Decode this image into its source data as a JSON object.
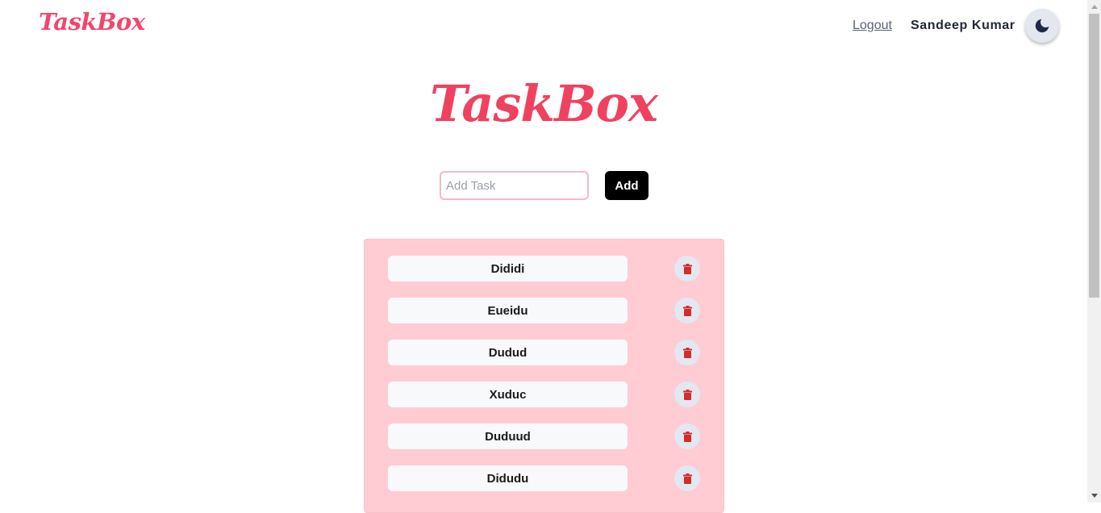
{
  "navbar": {
    "brand": "TaskBox",
    "logout_label": "Logout",
    "username": "Sandeep Kumar",
    "theme_icon": "moon-icon"
  },
  "main": {
    "title": "TaskBox",
    "input_placeholder": "Add Task",
    "input_value": "",
    "add_label": "Add"
  },
  "tasks": [
    {
      "label": "Dididi"
    },
    {
      "label": "Eueidu"
    },
    {
      "label": "Dudud"
    },
    {
      "label": "Xuduc"
    },
    {
      "label": "Duduud"
    },
    {
      "label": "Didudu"
    }
  ],
  "colors": {
    "brand": "#f0476c",
    "panel": "#ffccd3",
    "delete_icon": "#d42b2b"
  },
  "icons": {
    "delete": "trash-icon"
  }
}
